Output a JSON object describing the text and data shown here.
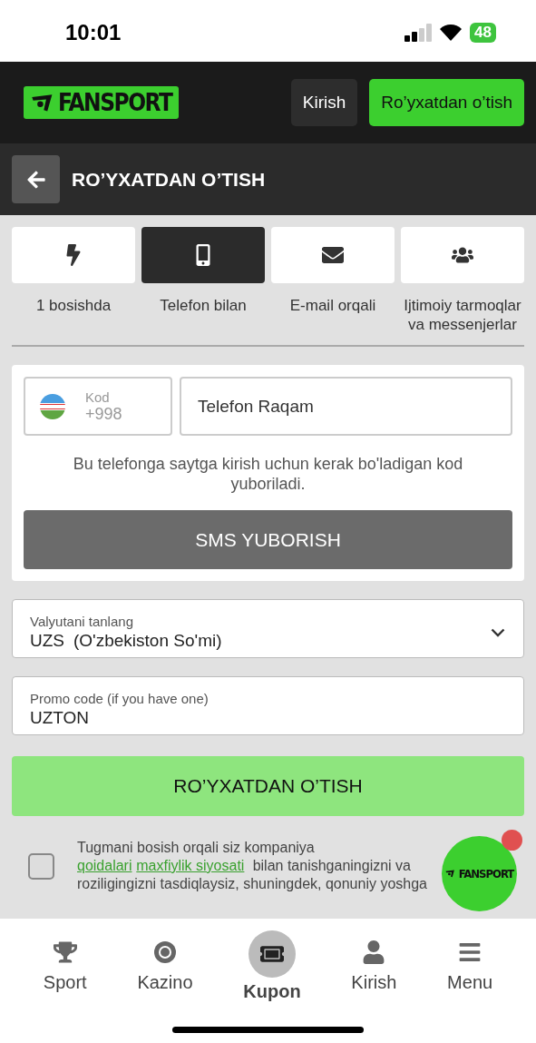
{
  "status_bar": {
    "time": "10:01",
    "battery": "48"
  },
  "header": {
    "logo": "FANSPORT",
    "buttons": [
      {
        "label": "Kirish",
        "kind": "secondary"
      },
      {
        "label": "Ro’yxatdan o’tish",
        "kind": "primary"
      }
    ]
  },
  "page_title": "RO’YXATDAN O’TISH",
  "methods": [
    {
      "label": "1 bosishda",
      "selected": false
    },
    {
      "label": "Telefon bilan",
      "selected": true
    },
    {
      "label": "E-mail orqali",
      "selected": false
    },
    {
      "label": "Ijtimoiy tarmoqlar va messenjerlar",
      "selected": false
    }
  ],
  "phone_form": {
    "code_label": "Kod",
    "code_value": "+998",
    "phone_placeholder": "Telefon Raqam",
    "hint": "Bu telefonga saytga kirish uchun kerak bo'ladigan kod yuboriladi.",
    "button": "SMS YUBORISH"
  },
  "currency": {
    "label": "Valyutani tanlang",
    "code": "UZS",
    "name": "(O'zbekiston So'mi)"
  },
  "promo": {
    "label": "Promo code (if you have one)",
    "value": "UZTON"
  },
  "submit": "RO’YXATDAN O’TISH",
  "consent": {
    "checked": false,
    "segments": [
      {
        "text": "Tugmani bosish orqali siz kompaniya ",
        "link": false
      },
      {
        "text": "qoidalari",
        "link": true
      },
      {
        "text": "maxfiylik siyosati",
        "link": true
      },
      {
        "text": " bilan tanishganingizni va roziligingizni tasdiqlaysiz, shuningdek, qonuniy yoshga",
        "link": false
      }
    ]
  },
  "float_button": {
    "logo": "FANSPORT",
    "badge": true
  },
  "nav": [
    {
      "label": "Sport",
      "selected": false
    },
    {
      "label": "Kazino",
      "selected": false
    },
    {
      "label": "Kupon",
      "selected": true
    },
    {
      "label": "Kirish",
      "selected": false
    },
    {
      "label": "Menu",
      "selected": false
    }
  ]
}
